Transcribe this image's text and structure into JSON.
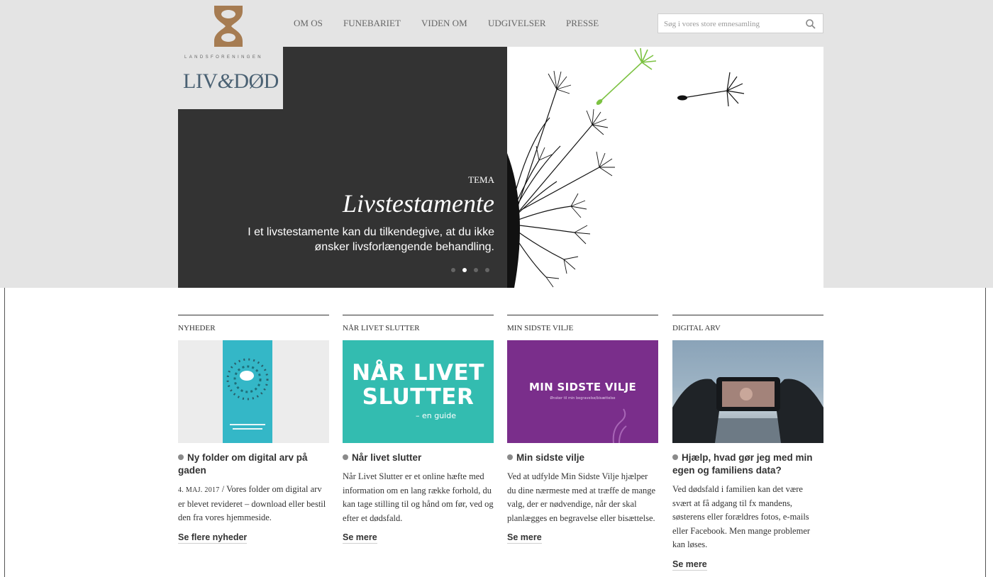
{
  "logo": {
    "small_text": "LANDSFORENINGEN",
    "name_part1": "LIV",
    "amp": "&",
    "name_part2": "DØD",
    "mark_color": "#a67c52",
    "name_color": "#4a6173"
  },
  "nav": {
    "items": [
      "OM OS",
      "FUNEBARIET",
      "VIDEN OM",
      "UDGIVELSER",
      "PRESSE"
    ]
  },
  "search": {
    "placeholder": "Søg i vores store emnesamling",
    "icon": "search-icon"
  },
  "hero": {
    "tag": "TEMA",
    "title": "Livstestamente",
    "text": "I et livstestamente kan du tilkendegive, at du ikke ønsker livsforlængende behandling.",
    "background_color": "#333333",
    "active_slide": 2,
    "slide_count": 4,
    "image": "dandelion-seeds-illustration",
    "accent_color": "#7cc242"
  },
  "columns": [
    {
      "category": "NYHEDER",
      "image": "digital-arv-folder",
      "title": "Ny folder om digital arv på gaden",
      "date": "4. MAJ. 2017",
      "separator": " / ",
      "body": "Vores folder om digital arv er blevet revideret – download eller bestil den fra vores hjemmeside.",
      "link": "Se flere nyheder"
    },
    {
      "category": "NÅR LIVET SLUTTER",
      "image_line1": "NÅR LIVET",
      "image_line2": "SLUTTER",
      "image_line3": "– en guide",
      "image_color": "#33bcb0",
      "title": "Når livet slutter",
      "body": "Når Livet Slutter er et online hæfte med information om en lang række forhold, du kan tage stilling til og hånd om før, ved og efter et dødsfald.",
      "link": "Se mere"
    },
    {
      "category": "MIN SIDSTE VILJE",
      "image_line1": "MIN SIDSTE VILJE",
      "image_line2": "Ønsker til min begravelse/bisættelse",
      "image_color": "#7a2e8b",
      "title": "Min sidste vilje",
      "body": "Ved at udfylde Min Sidste Vilje hjælper du dine nærmeste med at træffe de mange valg, der er nødvendige, når der skal planlægges en begravelse eller bisættelse.",
      "link": "Se mere"
    },
    {
      "category": "DIGITAL ARV",
      "image": "hands-holding-smartphone-photo",
      "title": "Hjælp, hvad gør jeg med min egen og familiens data?",
      "body": "Ved dødsfald i familien kan det være svært at få adgang til fx mandens, søsterens eller forældres fotos, e-mails eller Facebook. Men mange problemer kan løses.",
      "link": "Se mere"
    }
  ]
}
